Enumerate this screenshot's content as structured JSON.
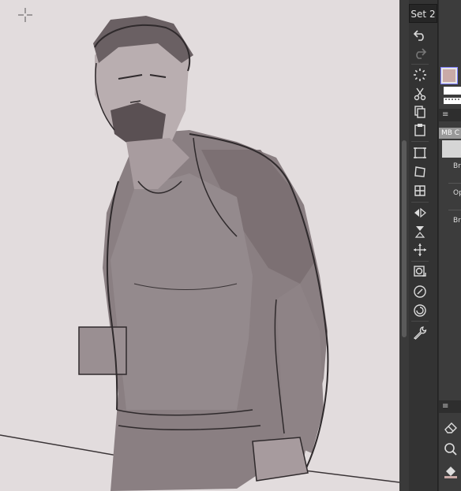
{
  "toolbar": {
    "set_label": "Set 2",
    "tools": [
      {
        "name": "undo-icon"
      },
      {
        "name": "redo-icon"
      },
      {
        "name": "loading-spinner-icon"
      },
      {
        "name": "cut-icon"
      },
      {
        "name": "copy-icon"
      },
      {
        "name": "paste-icon"
      },
      {
        "name": "transform-icon"
      },
      {
        "name": "free-transform-icon"
      },
      {
        "name": "mesh-transform-icon"
      },
      {
        "name": "flip-horizontal-icon"
      },
      {
        "name": "flip-vertical-icon"
      },
      {
        "name": "move-icon"
      },
      {
        "name": "layer-icon"
      },
      {
        "name": "rotate-icon"
      },
      {
        "name": "rotate-reset-icon"
      },
      {
        "name": "settings-wrench-icon"
      }
    ]
  },
  "color": {
    "main_color": "#c9aaa7"
  },
  "brush_panel": {
    "tab_label": "MB C",
    "labels": [
      "Br",
      "Op",
      "Br"
    ]
  },
  "bottom_panel": {
    "tools": [
      {
        "name": "eraser-icon"
      },
      {
        "name": "zoom-icon"
      },
      {
        "name": "fill-icon"
      }
    ]
  }
}
